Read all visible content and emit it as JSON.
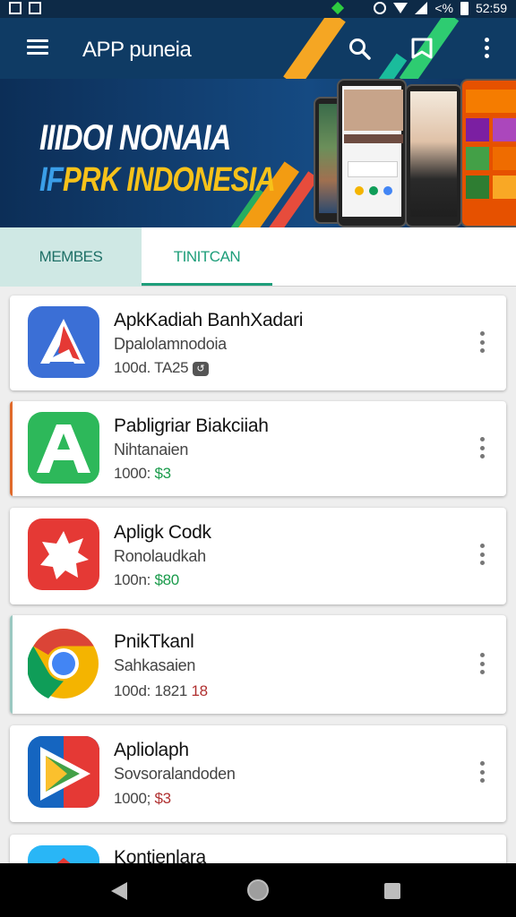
{
  "status_bar": {
    "time": "52:59",
    "battery_text": "<%"
  },
  "app_bar": {
    "title": "APP puneia",
    "icons": [
      "menu-icon",
      "search-icon",
      "bookmark-icon",
      "more-vert-icon"
    ]
  },
  "banner": {
    "line1": "IIIDOI NONAIA",
    "line2_prefix": "IF",
    "line2_rest": "PRK INDONESIA"
  },
  "tabs": [
    {
      "label": "MEMBES",
      "selected": false
    },
    {
      "label": "TINITCAN",
      "selected": true
    }
  ],
  "apps": [
    {
      "title": "ApkKadiah BanhXadari",
      "subtitle": "Dpalolamnodoia",
      "meta": "100d. TA25",
      "badge": "↺",
      "icon": "red-triangle-logo-icon",
      "accent": "#3b6fd6"
    },
    {
      "title": "Pabligriar Biakciiah",
      "subtitle": "Nihtanaien",
      "meta_prefix": "1000: ",
      "price": "$3",
      "icon": "green-a-logo-icon",
      "accent": "#2db85a"
    },
    {
      "title": "Apligk Codk",
      "subtitle": "Ronolaudkah",
      "meta_prefix": "100n: ",
      "price": "$80",
      "icon": "red-star-icon",
      "accent": "#e53935"
    },
    {
      "title": "PnikTkanl",
      "subtitle": "Sahkasaien",
      "meta_prefix": "100d: 1821 ",
      "price": "18",
      "icon": "chrome-like-icon",
      "accent": "#4285f4"
    },
    {
      "title": "Apliolaph",
      "subtitle": "Sovsoralandoden",
      "meta_prefix": "1000; ",
      "price": "$3",
      "icon": "play-store-like-icon",
      "accent": "#1e88e5"
    },
    {
      "title": "Kontienlara",
      "subtitle": "",
      "meta_prefix": "",
      "price": "",
      "icon": "blue-app-icon",
      "accent": "#29b6f6"
    }
  ],
  "nav_bar": {
    "icons": [
      "back-icon",
      "home-icon",
      "recents-icon"
    ]
  }
}
